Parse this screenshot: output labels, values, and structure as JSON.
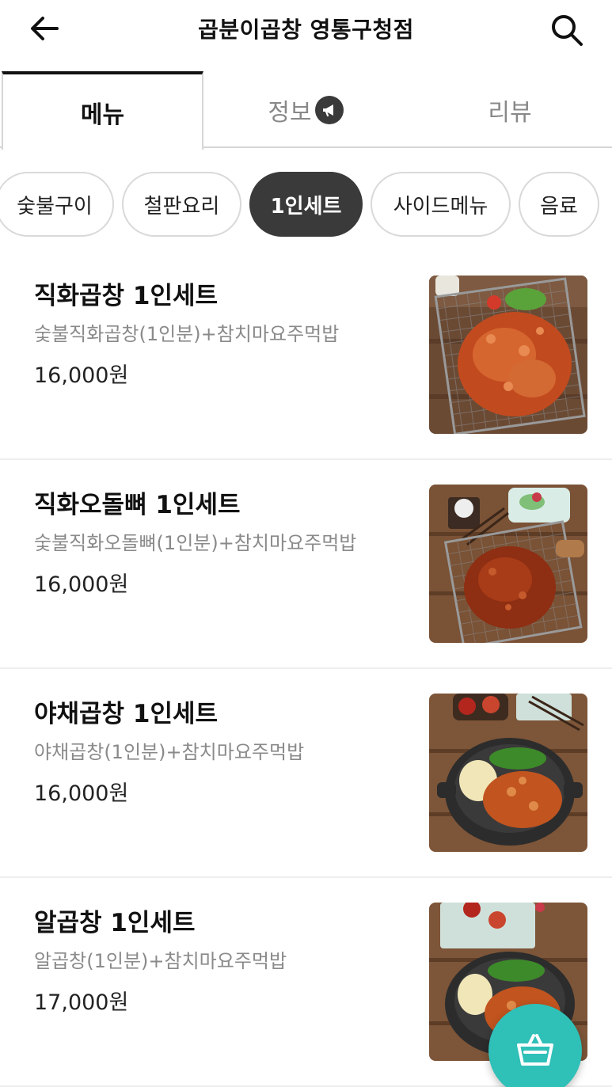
{
  "header": {
    "title": "곱분이곱창 영통구청점",
    "back_icon": "arrow-left-icon",
    "search_icon": "search-icon"
  },
  "tabs": [
    {
      "label": "메뉴",
      "active": true
    },
    {
      "label": "정보",
      "active": false,
      "badge_icon": "megaphone-icon"
    },
    {
      "label": "리뷰",
      "active": false
    }
  ],
  "categories": [
    {
      "label": "숯불구이",
      "active": false
    },
    {
      "label": "철판요리",
      "active": false
    },
    {
      "label": "1인세트",
      "active": true
    },
    {
      "label": "사이드메뉴",
      "active": false
    },
    {
      "label": "음료",
      "active": false
    }
  ],
  "menu_items": [
    {
      "name": "직화곱창 1인세트",
      "description": "숯불직화곱창(1인분)+참치마요주먹밥",
      "price": "16,000원"
    },
    {
      "name": "직화오돌뼈 1인세트",
      "description": "숯불직화오돌뼈(1인분)+참치마요주먹밥",
      "price": "16,000원"
    },
    {
      "name": "야채곱창 1인세트",
      "description": "야채곱창(1인분)+참치마요주먹밥",
      "price": "16,000원"
    },
    {
      "name": "알곱창 1인세트",
      "description": "알곱창(1인분)+참치마요주먹밥",
      "price": "17,000원"
    }
  ],
  "cart": {
    "icon": "basket-icon"
  },
  "colors": {
    "accent_teal": "#2fc0b8",
    "active_chip": "#3a3a3a",
    "muted_text": "#8a8a8a",
    "divider": "#eeeeee"
  }
}
